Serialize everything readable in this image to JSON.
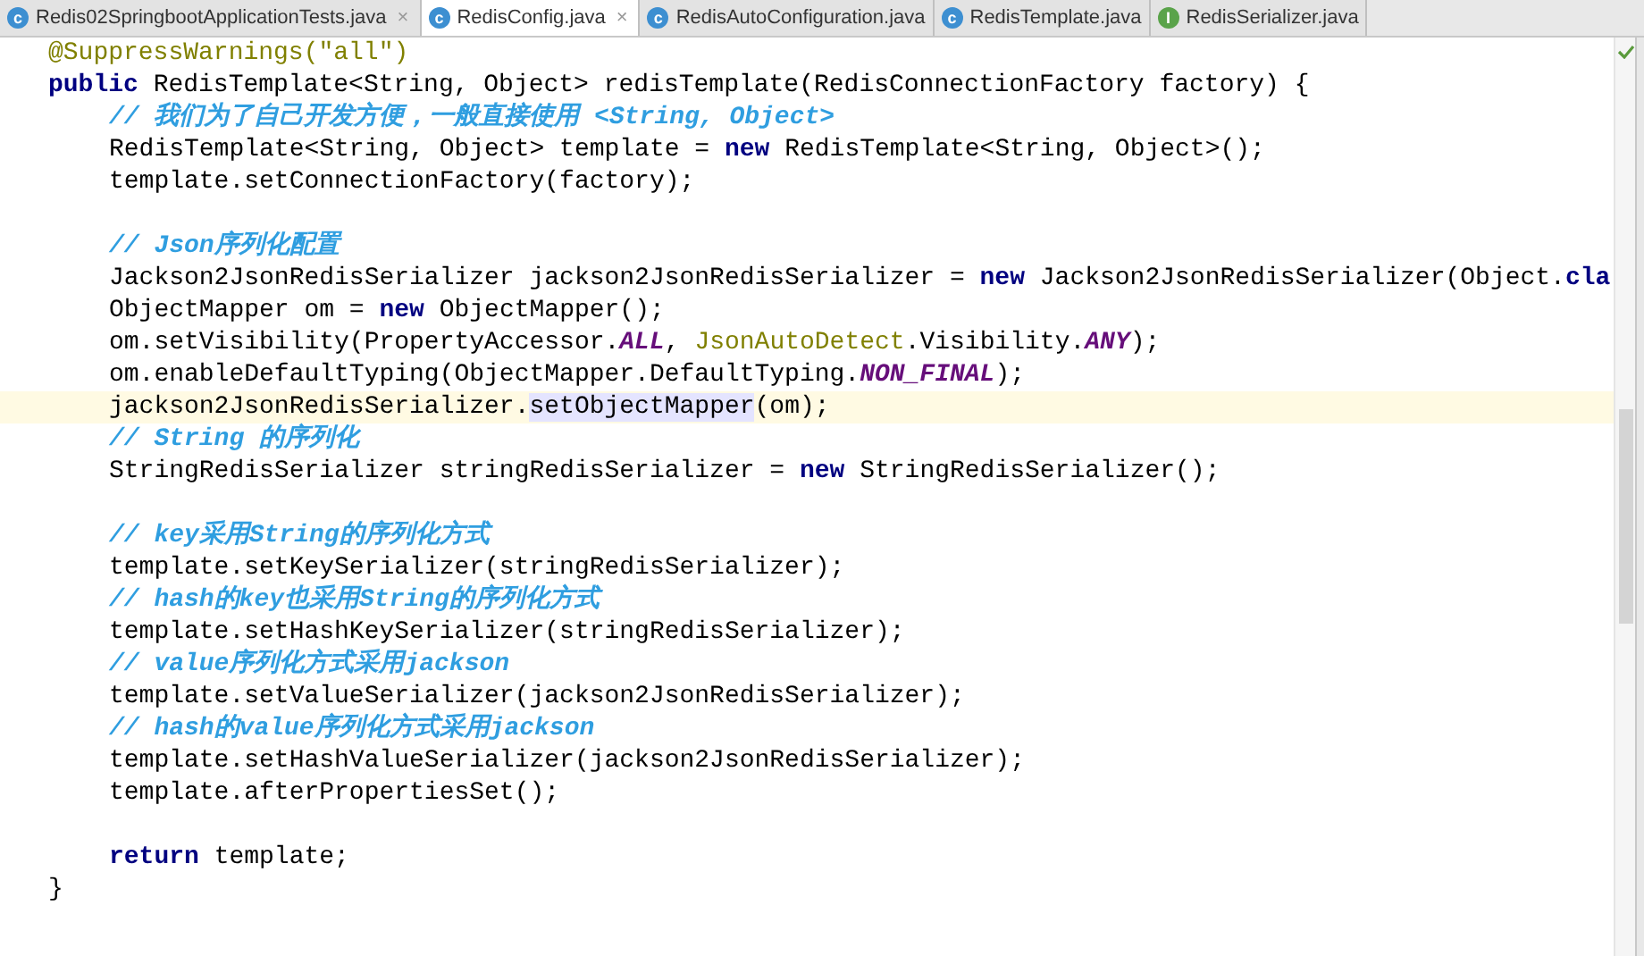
{
  "tabs": [
    {
      "label": "Redis02SpringbootApplicationTests.java",
      "kind": "class",
      "icon": "c",
      "selected": false,
      "close": "×"
    },
    {
      "label": "RedisConfig.java",
      "kind": "class",
      "icon": "c",
      "selected": true,
      "close": "×"
    },
    {
      "label": "RedisAutoConfiguration.java",
      "kind": "class",
      "icon": "c",
      "selected": false
    },
    {
      "label": "RedisTemplate.java",
      "kind": "class",
      "icon": "c",
      "selected": false
    },
    {
      "label": "RedisSerializer.java",
      "kind": "interface",
      "icon": "I",
      "selected": false
    }
  ],
  "lines": [
    {
      "kind": "code",
      "tokens": [
        {
          "t": "@SuppressWarnings(\"all\")",
          "kind": "annotation"
        }
      ]
    },
    {
      "kind": "code",
      "tokens": [
        {
          "t": "public",
          "kind": "keyword"
        },
        {
          "t": " RedisTemplate<String, Object> redisTemplate(RedisConnectionFactory factory) {",
          "kind": "plain"
        }
      ],
      "children": [
        {
          "kind": "code",
          "tokens": [
            {
              "t": "// 我们为了自己开发方便，一般直接使用 <String, Object>",
              "kind": "comment"
            }
          ]
        },
        {
          "kind": "code",
          "tokens": [
            {
              "t": "RedisTemplate<String, Object> template = ",
              "kind": "plain"
            },
            {
              "t": "new",
              "kind": "keyword"
            },
            {
              "t": " RedisTemplate<String, Object>();",
              "kind": "plain"
            }
          ]
        },
        {
          "kind": "code",
          "tokens": [
            {
              "t": "template.setConnectionFactory(factory);",
              "kind": "plain"
            }
          ]
        },
        {
          "kind": "blank"
        },
        {
          "kind": "code",
          "tokens": [
            {
              "t": "// Json序列化配置",
              "kind": "comment"
            }
          ]
        },
        {
          "kind": "code",
          "tokens": [
            {
              "t": "Jackson2JsonRedisSerializer jackson2JsonRedisSerializer = ",
              "kind": "plain"
            },
            {
              "t": "new",
              "kind": "keyword"
            },
            {
              "t": " Jackson2JsonRedisSerializer(Object.",
              "kind": "plain"
            },
            {
              "t": "cla",
              "kind": "keyword"
            }
          ]
        },
        {
          "kind": "code",
          "tokens": [
            {
              "t": "ObjectMapper om = ",
              "kind": "plain"
            },
            {
              "t": "new",
              "kind": "keyword"
            },
            {
              "t": " ObjectMapper();",
              "kind": "plain"
            }
          ]
        },
        {
          "kind": "code",
          "tokens": [
            {
              "t": "om.setVisibility(PropertyAccessor.",
              "kind": "plain"
            },
            {
              "t": "ALL",
              "kind": "constant"
            },
            {
              "t": ", ",
              "kind": "plain"
            },
            {
              "t": "JsonAutoDetect",
              "kind": "warning"
            },
            {
              "t": ".Visibility.",
              "kind": "plain"
            },
            {
              "t": "ANY",
              "kind": "constant"
            },
            {
              "t": ");",
              "kind": "plain"
            }
          ]
        },
        {
          "kind": "code",
          "tokens": [
            {
              "t": "om.enableDefaultTyping(ObjectMapper.DefaultTyping.",
              "kind": "plain"
            },
            {
              "t": "NON_FINAL",
              "kind": "constant"
            },
            {
              "t": ");",
              "kind": "plain"
            }
          ]
        },
        {
          "kind": "code",
          "current": true,
          "tokens": [
            {
              "t": "jackson2JsonRedisSerializer.",
              "kind": "plain"
            },
            {
              "t": "setObjectMapper",
              "kind": "highlight"
            },
            {
              "t": "(om);",
              "kind": "plain"
            }
          ]
        },
        {
          "kind": "code",
          "tokens": [
            {
              "t": "// String 的序列化",
              "kind": "comment"
            }
          ]
        },
        {
          "kind": "code",
          "tokens": [
            {
              "t": "StringRedisSerializer stringRedisSerializer = ",
              "kind": "plain"
            },
            {
              "t": "new",
              "kind": "keyword"
            },
            {
              "t": " StringRedisSerializer();",
              "kind": "plain"
            }
          ]
        },
        {
          "kind": "blank"
        },
        {
          "kind": "code",
          "tokens": [
            {
              "t": "// key采用String的序列化方式",
              "kind": "comment"
            }
          ]
        },
        {
          "kind": "code",
          "tokens": [
            {
              "t": "template.setKeySerializer(stringRedisSerializer);",
              "kind": "plain"
            }
          ]
        },
        {
          "kind": "code",
          "tokens": [
            {
              "t": "// hash的key也采用String的序列化方式",
              "kind": "comment"
            }
          ]
        },
        {
          "kind": "code",
          "tokens": [
            {
              "t": "template.setHashKeySerializer(stringRedisSerializer);",
              "kind": "plain"
            }
          ]
        },
        {
          "kind": "code",
          "tokens": [
            {
              "t": "// value序列化方式采用jackson",
              "kind": "comment"
            }
          ]
        },
        {
          "kind": "code",
          "tokens": [
            {
              "t": "template.setValueSerializer(jackson2JsonRedisSerializer);",
              "kind": "plain"
            }
          ]
        },
        {
          "kind": "code",
          "tokens": [
            {
              "t": "// hash的value序列化方式采用jackson",
              "kind": "comment"
            }
          ]
        },
        {
          "kind": "code",
          "tokens": [
            {
              "t": "template.setHashValueSerializer(jackson2JsonRedisSerializer);",
              "kind": "plain"
            }
          ]
        },
        {
          "kind": "code",
          "tokens": [
            {
              "t": "template.afterPropertiesSet();",
              "kind": "plain"
            }
          ]
        },
        {
          "kind": "blank"
        },
        {
          "kind": "code",
          "tokens": [
            {
              "t": "return",
              "kind": "keyword"
            },
            {
              "t": " template;",
              "kind": "plain"
            }
          ]
        }
      ]
    },
    {
      "kind": "code",
      "tokens": [
        {
          "t": "}",
          "kind": "plain"
        }
      ]
    }
  ]
}
